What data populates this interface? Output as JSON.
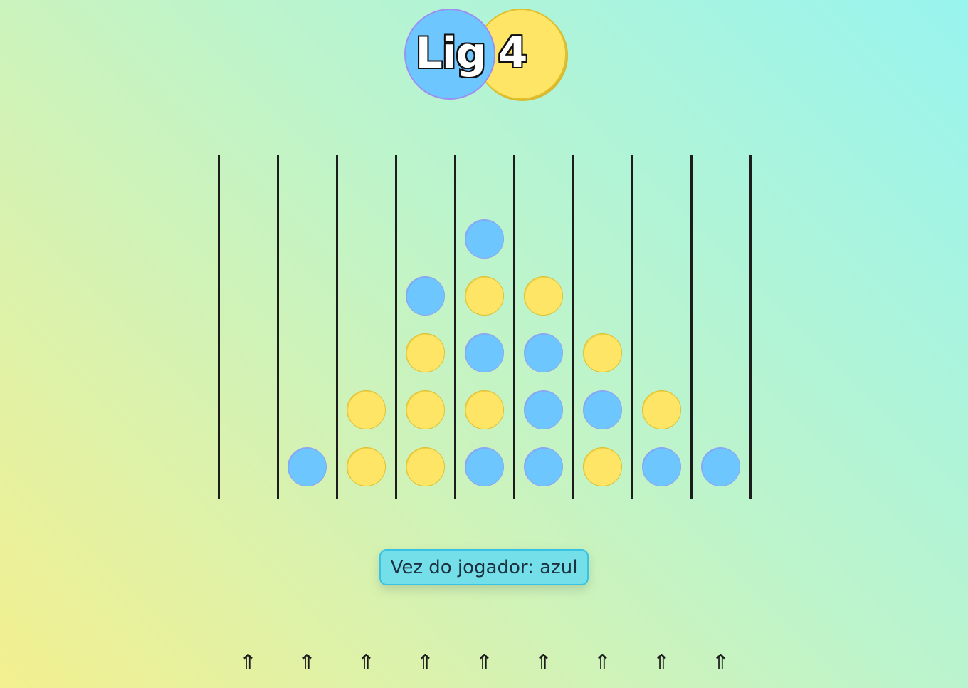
{
  "logo": {
    "left_text": "Lig",
    "right_text": "4",
    "colors": {
      "blue": "#6ec6ff",
      "yellow": "#ffe566"
    }
  },
  "board": {
    "columns": 9,
    "rows": 6,
    "column_arrow_icon": "⇑",
    "grid_bottom_to_top": [
      [
        null,
        null,
        null,
        null,
        null,
        null
      ],
      [
        "blue",
        null,
        null,
        null,
        null,
        null
      ],
      [
        "yellow",
        "yellow",
        null,
        null,
        null,
        null
      ],
      [
        "yellow",
        "yellow",
        "yellow",
        "blue",
        null,
        null
      ],
      [
        "blue",
        "yellow",
        "blue",
        "yellow",
        "blue",
        null
      ],
      [
        "blue",
        "blue",
        "blue",
        "yellow",
        null,
        null
      ],
      [
        "yellow",
        "blue",
        "yellow",
        null,
        null,
        null
      ],
      [
        "blue",
        "yellow",
        null,
        null,
        null,
        null
      ],
      [
        "blue",
        null,
        null,
        null,
        null,
        null
      ]
    ],
    "colors": {
      "blue": "#6ec6ff",
      "yellow": "#ffe566",
      "line": "#1c1c1c"
    }
  },
  "status": {
    "text": "Vez do jogador: azul",
    "current_player": "azul"
  }
}
